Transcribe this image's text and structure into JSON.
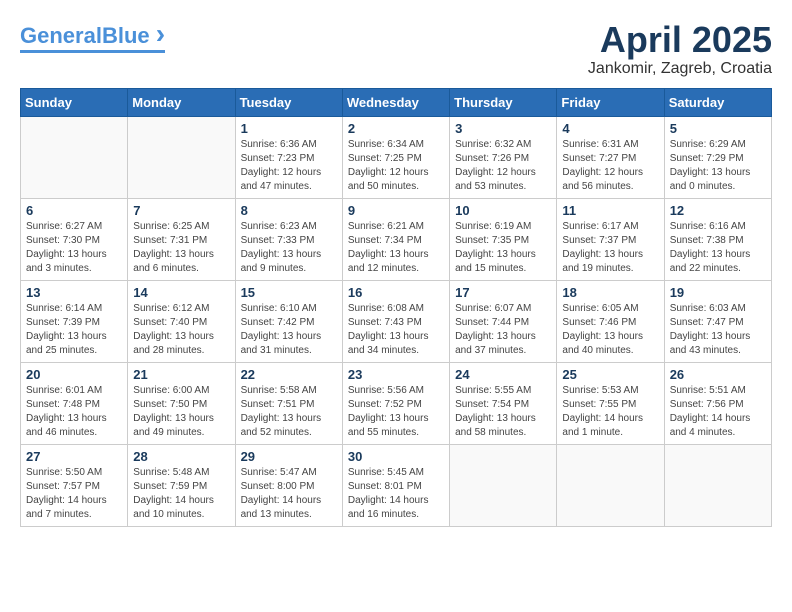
{
  "header": {
    "logo_general": "General",
    "logo_blue": "Blue",
    "month_title": "April 2025",
    "location": "Jankomir, Zagreb, Croatia"
  },
  "weekdays": [
    "Sunday",
    "Monday",
    "Tuesday",
    "Wednesday",
    "Thursday",
    "Friday",
    "Saturday"
  ],
  "weeks": [
    [
      {
        "day": "",
        "sunrise": "",
        "sunset": "",
        "daylight": ""
      },
      {
        "day": "",
        "sunrise": "",
        "sunset": "",
        "daylight": ""
      },
      {
        "day": "1",
        "sunrise": "Sunrise: 6:36 AM",
        "sunset": "Sunset: 7:23 PM",
        "daylight": "Daylight: 12 hours and 47 minutes."
      },
      {
        "day": "2",
        "sunrise": "Sunrise: 6:34 AM",
        "sunset": "Sunset: 7:25 PM",
        "daylight": "Daylight: 12 hours and 50 minutes."
      },
      {
        "day": "3",
        "sunrise": "Sunrise: 6:32 AM",
        "sunset": "Sunset: 7:26 PM",
        "daylight": "Daylight: 12 hours and 53 minutes."
      },
      {
        "day": "4",
        "sunrise": "Sunrise: 6:31 AM",
        "sunset": "Sunset: 7:27 PM",
        "daylight": "Daylight: 12 hours and 56 minutes."
      },
      {
        "day": "5",
        "sunrise": "Sunrise: 6:29 AM",
        "sunset": "Sunset: 7:29 PM",
        "daylight": "Daylight: 13 hours and 0 minutes."
      }
    ],
    [
      {
        "day": "6",
        "sunrise": "Sunrise: 6:27 AM",
        "sunset": "Sunset: 7:30 PM",
        "daylight": "Daylight: 13 hours and 3 minutes."
      },
      {
        "day": "7",
        "sunrise": "Sunrise: 6:25 AM",
        "sunset": "Sunset: 7:31 PM",
        "daylight": "Daylight: 13 hours and 6 minutes."
      },
      {
        "day": "8",
        "sunrise": "Sunrise: 6:23 AM",
        "sunset": "Sunset: 7:33 PM",
        "daylight": "Daylight: 13 hours and 9 minutes."
      },
      {
        "day": "9",
        "sunrise": "Sunrise: 6:21 AM",
        "sunset": "Sunset: 7:34 PM",
        "daylight": "Daylight: 13 hours and 12 minutes."
      },
      {
        "day": "10",
        "sunrise": "Sunrise: 6:19 AM",
        "sunset": "Sunset: 7:35 PM",
        "daylight": "Daylight: 13 hours and 15 minutes."
      },
      {
        "day": "11",
        "sunrise": "Sunrise: 6:17 AM",
        "sunset": "Sunset: 7:37 PM",
        "daylight": "Daylight: 13 hours and 19 minutes."
      },
      {
        "day": "12",
        "sunrise": "Sunrise: 6:16 AM",
        "sunset": "Sunset: 7:38 PM",
        "daylight": "Daylight: 13 hours and 22 minutes."
      }
    ],
    [
      {
        "day": "13",
        "sunrise": "Sunrise: 6:14 AM",
        "sunset": "Sunset: 7:39 PM",
        "daylight": "Daylight: 13 hours and 25 minutes."
      },
      {
        "day": "14",
        "sunrise": "Sunrise: 6:12 AM",
        "sunset": "Sunset: 7:40 PM",
        "daylight": "Daylight: 13 hours and 28 minutes."
      },
      {
        "day": "15",
        "sunrise": "Sunrise: 6:10 AM",
        "sunset": "Sunset: 7:42 PM",
        "daylight": "Daylight: 13 hours and 31 minutes."
      },
      {
        "day": "16",
        "sunrise": "Sunrise: 6:08 AM",
        "sunset": "Sunset: 7:43 PM",
        "daylight": "Daylight: 13 hours and 34 minutes."
      },
      {
        "day": "17",
        "sunrise": "Sunrise: 6:07 AM",
        "sunset": "Sunset: 7:44 PM",
        "daylight": "Daylight: 13 hours and 37 minutes."
      },
      {
        "day": "18",
        "sunrise": "Sunrise: 6:05 AM",
        "sunset": "Sunset: 7:46 PM",
        "daylight": "Daylight: 13 hours and 40 minutes."
      },
      {
        "day": "19",
        "sunrise": "Sunrise: 6:03 AM",
        "sunset": "Sunset: 7:47 PM",
        "daylight": "Daylight: 13 hours and 43 minutes."
      }
    ],
    [
      {
        "day": "20",
        "sunrise": "Sunrise: 6:01 AM",
        "sunset": "Sunset: 7:48 PM",
        "daylight": "Daylight: 13 hours and 46 minutes."
      },
      {
        "day": "21",
        "sunrise": "Sunrise: 6:00 AM",
        "sunset": "Sunset: 7:50 PM",
        "daylight": "Daylight: 13 hours and 49 minutes."
      },
      {
        "day": "22",
        "sunrise": "Sunrise: 5:58 AM",
        "sunset": "Sunset: 7:51 PM",
        "daylight": "Daylight: 13 hours and 52 minutes."
      },
      {
        "day": "23",
        "sunrise": "Sunrise: 5:56 AM",
        "sunset": "Sunset: 7:52 PM",
        "daylight": "Daylight: 13 hours and 55 minutes."
      },
      {
        "day": "24",
        "sunrise": "Sunrise: 5:55 AM",
        "sunset": "Sunset: 7:54 PM",
        "daylight": "Daylight: 13 hours and 58 minutes."
      },
      {
        "day": "25",
        "sunrise": "Sunrise: 5:53 AM",
        "sunset": "Sunset: 7:55 PM",
        "daylight": "Daylight: 14 hours and 1 minute."
      },
      {
        "day": "26",
        "sunrise": "Sunrise: 5:51 AM",
        "sunset": "Sunset: 7:56 PM",
        "daylight": "Daylight: 14 hours and 4 minutes."
      }
    ],
    [
      {
        "day": "27",
        "sunrise": "Sunrise: 5:50 AM",
        "sunset": "Sunset: 7:57 PM",
        "daylight": "Daylight: 14 hours and 7 minutes."
      },
      {
        "day": "28",
        "sunrise": "Sunrise: 5:48 AM",
        "sunset": "Sunset: 7:59 PM",
        "daylight": "Daylight: 14 hours and 10 minutes."
      },
      {
        "day": "29",
        "sunrise": "Sunrise: 5:47 AM",
        "sunset": "Sunset: 8:00 PM",
        "daylight": "Daylight: 14 hours and 13 minutes."
      },
      {
        "day": "30",
        "sunrise": "Sunrise: 5:45 AM",
        "sunset": "Sunset: 8:01 PM",
        "daylight": "Daylight: 14 hours and 16 minutes."
      },
      {
        "day": "",
        "sunrise": "",
        "sunset": "",
        "daylight": ""
      },
      {
        "day": "",
        "sunrise": "",
        "sunset": "",
        "daylight": ""
      },
      {
        "day": "",
        "sunrise": "",
        "sunset": "",
        "daylight": ""
      }
    ]
  ]
}
